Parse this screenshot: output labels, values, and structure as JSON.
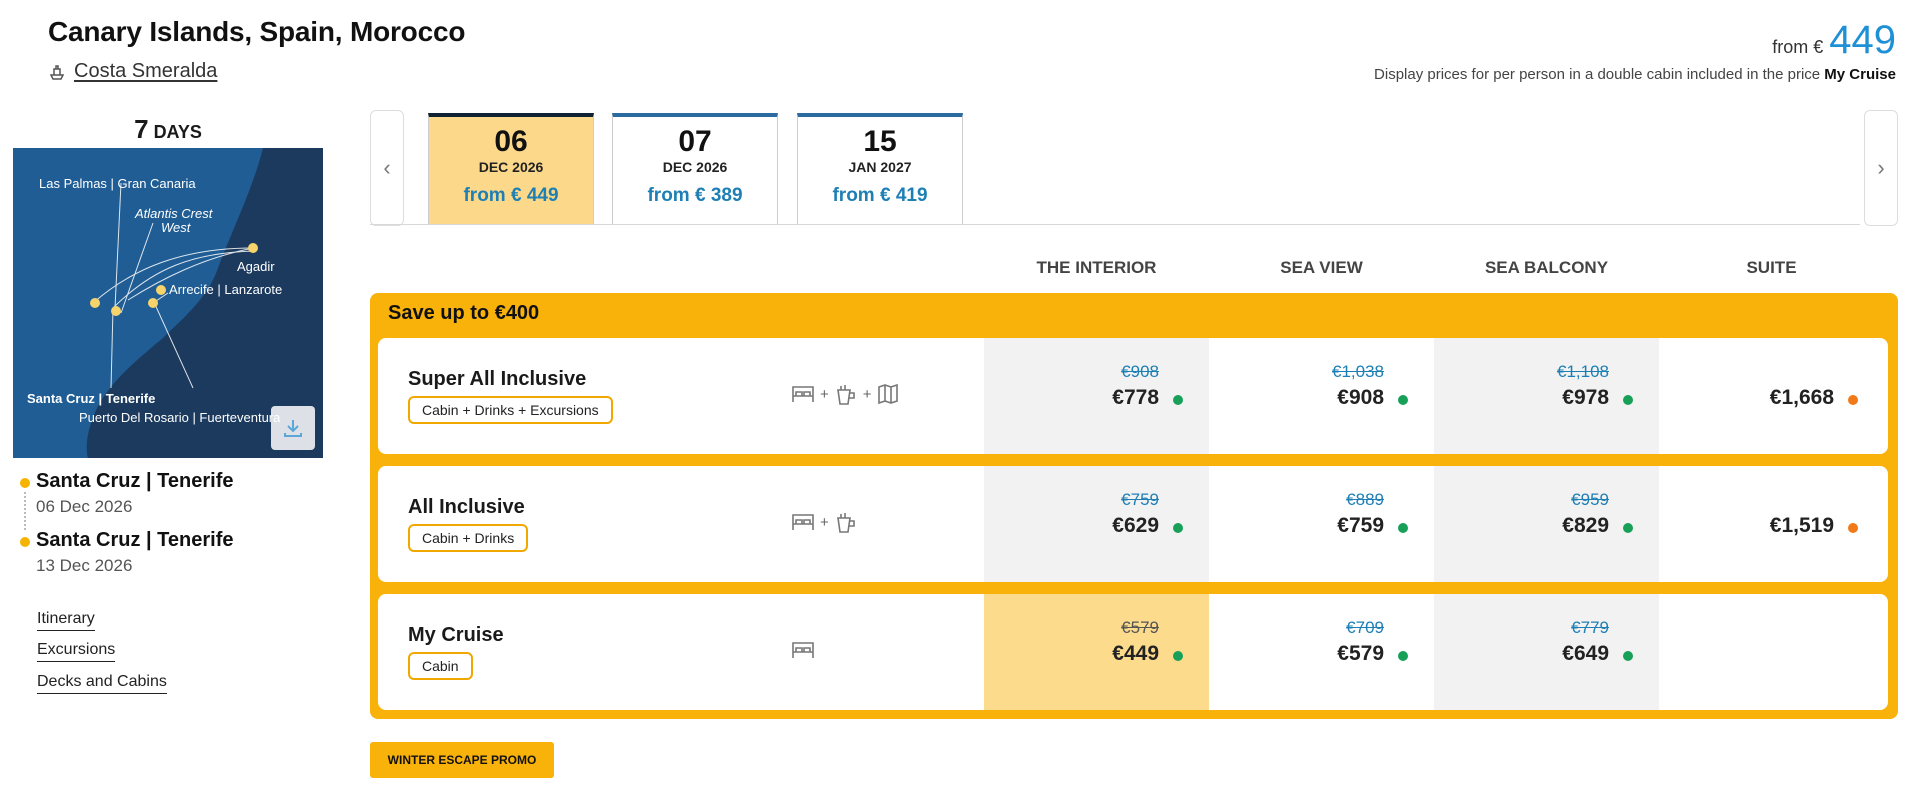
{
  "header": {
    "title": "Canary Islands, Spain, Morocco",
    "ship": "Costa Smeralda",
    "price_from_label": "from €",
    "price_from_value": "449",
    "price_note": "Display prices for per person in a double cabin included in the price",
    "price_note_bold": "My Cruise"
  },
  "sidebar": {
    "days_num": "7",
    "days_label": "DAYS",
    "map_labels": {
      "las_palmas": "Las Palmas | Gran Canaria",
      "atlantis": "Atlantis Crest",
      "atlantis2": "West",
      "agadir": "Agadir",
      "arrecife": "Arrecife | Lanzarote",
      "santa_cruz": "Santa Cruz | Tenerife",
      "puerto": "Puerto Del Rosario | Fuerteventura"
    },
    "departure_port": "Santa Cruz | Tenerife",
    "departure_date": "06 Dec 2026",
    "arrival_port": "Santa Cruz | Tenerife",
    "arrival_date": "13 Dec 2026",
    "links": [
      "Itinerary",
      "Excursions",
      "Decks and Cabins"
    ]
  },
  "dates": [
    {
      "day": "06",
      "month": "DEC 2026",
      "from": "from € 449"
    },
    {
      "day": "07",
      "month": "DEC 2026",
      "from": "from € 389"
    },
    {
      "day": "15",
      "month": "JAN 2027",
      "from": "from € 419"
    }
  ],
  "columns": [
    "THE INTERIOR",
    "SEA VIEW",
    "SEA BALCONY",
    "SUITE"
  ],
  "promo": {
    "title": "Save up to €400",
    "button": "WINTER ESCAPE PROMO"
  },
  "packages": [
    {
      "name": "Super All Inclusive",
      "tag": "Cabin + Drinks + Excursions",
      "icons": [
        "bed-icon",
        "drink-icon",
        "map-icon"
      ],
      "prices": [
        {
          "old": "€908",
          "new": "€778",
          "status": "#18a058"
        },
        {
          "old": "€1,038",
          "new": "€908",
          "status": "#18a058"
        },
        {
          "old": "€1,108",
          "new": "€978",
          "status": "#18a058"
        },
        {
          "old": "",
          "new": "€1,668",
          "status": "#f07a1a"
        }
      ]
    },
    {
      "name": "All Inclusive",
      "tag": "Cabin + Drinks",
      "icons": [
        "bed-icon",
        "drink-icon"
      ],
      "prices": [
        {
          "old": "€759",
          "new": "€629",
          "status": "#18a058"
        },
        {
          "old": "€889",
          "new": "€759",
          "status": "#18a058"
        },
        {
          "old": "€959",
          "new": "€829",
          "status": "#18a058"
        },
        {
          "old": "",
          "new": "€1,519",
          "status": "#f07a1a"
        }
      ]
    },
    {
      "name": "My Cruise",
      "tag": "Cabin",
      "icons": [
        "bed-icon"
      ],
      "prices": [
        {
          "old": "€579",
          "new": "€449",
          "status": "#18a058"
        },
        {
          "old": "€709",
          "new": "€579",
          "status": "#18a058"
        },
        {
          "old": "€779",
          "new": "€649",
          "status": "#18a058"
        }
      ]
    }
  ],
  "colors": {
    "accent": "#f9b20a",
    "price_blue": "#1e90d6",
    "highlight": "#fcd98a"
  }
}
